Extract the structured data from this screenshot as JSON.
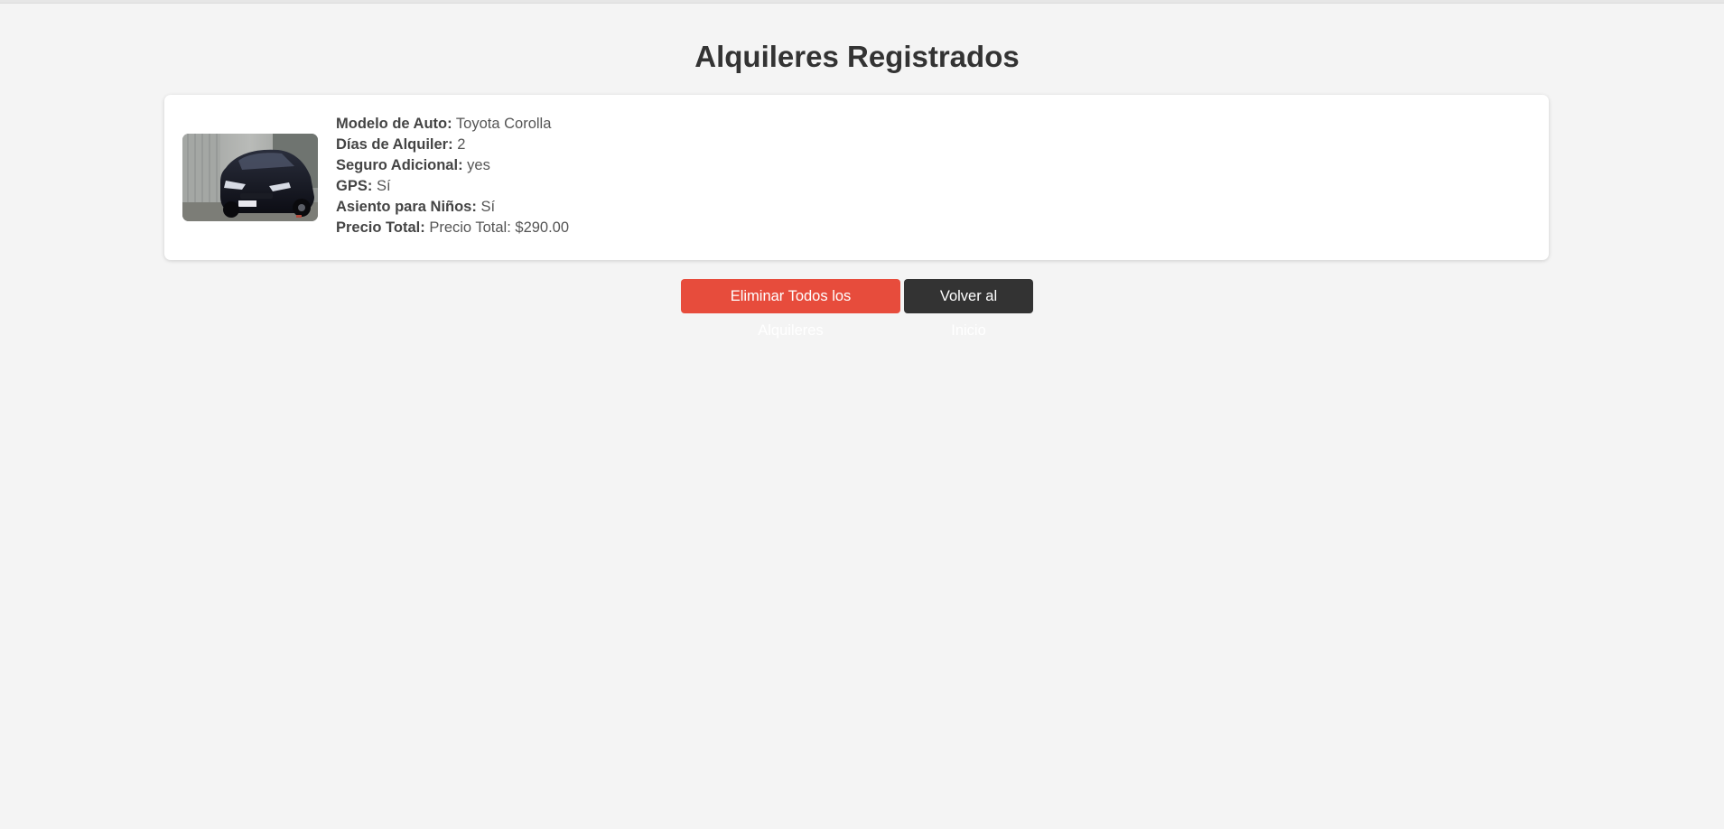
{
  "page": {
    "title": "Alquileres Registrados"
  },
  "rentals": [
    {
      "image_alt": "Toyota Corolla",
      "fields": [
        {
          "label": "Modelo de Auto:",
          "value": "Toyota Corolla"
        },
        {
          "label": "Días de Alquiler:",
          "value": "2"
        },
        {
          "label": "Seguro Adicional:",
          "value": "yes"
        },
        {
          "label": "GPS:",
          "value": "Sí"
        },
        {
          "label": "Asiento para Niños:",
          "value": "Sí"
        },
        {
          "label": "Precio Total:",
          "value": "Precio Total: $290.00"
        }
      ]
    }
  ],
  "actions": {
    "delete_all_label": "Eliminar Todos los Alquileres",
    "home_label": "Volver al Inicio"
  },
  "colors": {
    "background": "#f4f4f4",
    "card": "#ffffff",
    "delete_button": "#e74c3c",
    "home_button": "#333333",
    "text": "#333333"
  }
}
